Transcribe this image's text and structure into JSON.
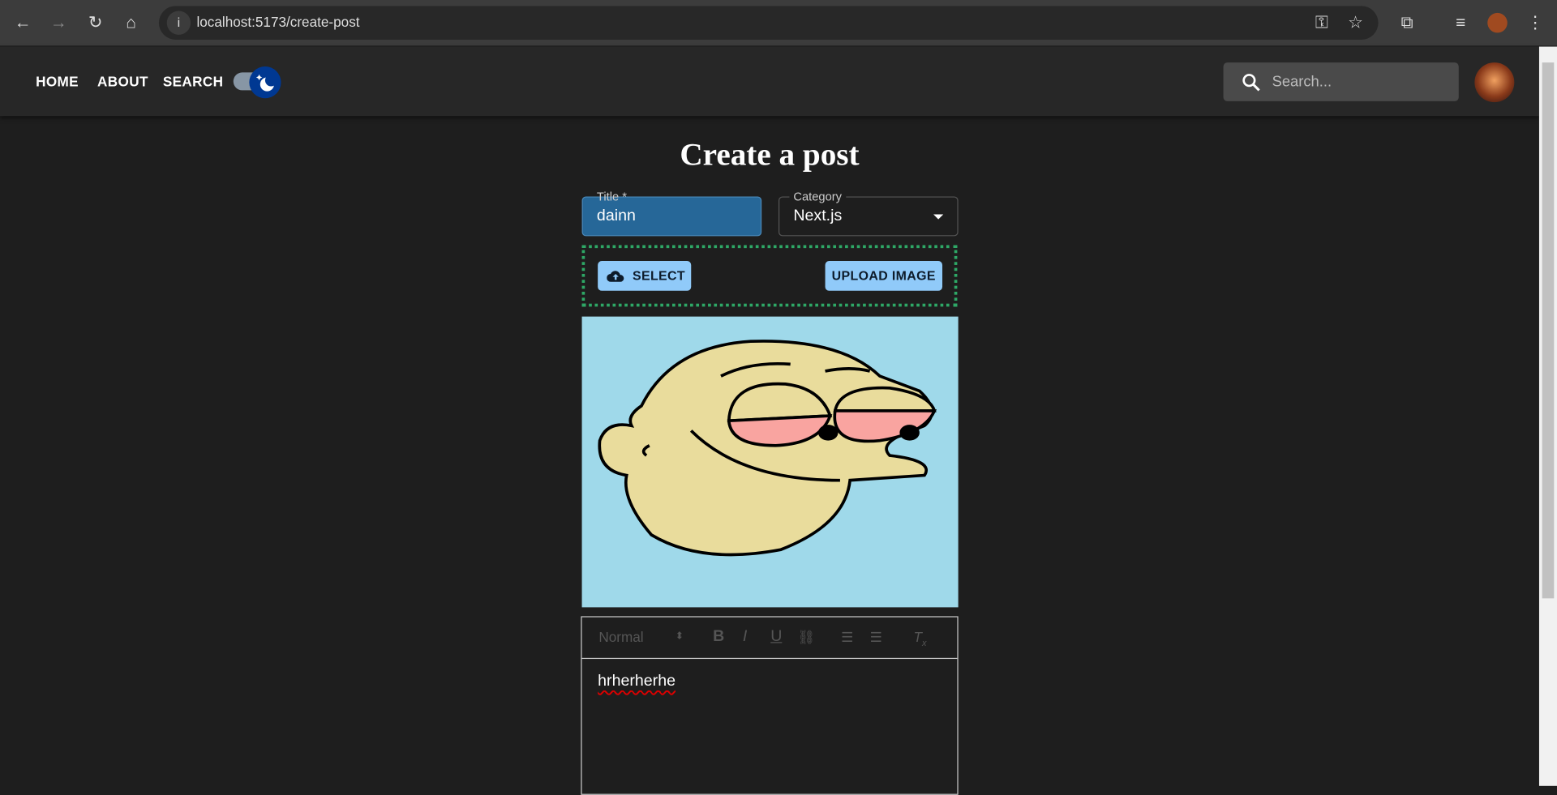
{
  "browser": {
    "url": "localhost:5173/create-post"
  },
  "nav": {
    "links": [
      "HOME",
      "ABOUT",
      "SEARCH"
    ],
    "dark_mode": true
  },
  "search": {
    "placeholder": "Search..."
  },
  "page": {
    "title": "Create a post"
  },
  "form": {
    "title_label": "Title *",
    "title_value": "dainn",
    "category_label": "Category",
    "category_value": "Next.js",
    "select_label": "SELECT",
    "upload_label": "UPLOAD IMAGE",
    "editor": {
      "format": "Normal",
      "content": "hrherherhe"
    }
  },
  "colors": {
    "accent": "#90caf9",
    "title_fill": "#266798",
    "upload_border": "#2ea866",
    "toggle": "#003892"
  }
}
